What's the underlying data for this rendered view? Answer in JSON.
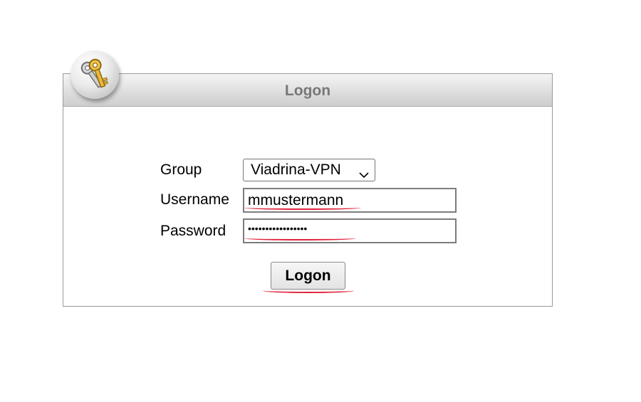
{
  "panel": {
    "title": "Logon"
  },
  "icons": {
    "badge": "keys-icon"
  },
  "form": {
    "group_label": "Group",
    "group_value": "Viadrina-VPN",
    "username_label": "Username",
    "username_value": "mmustermann",
    "password_label": "Password",
    "password_mask": "•••••••••••••••••"
  },
  "actions": {
    "logon_label": "Logon"
  },
  "colors": {
    "spellcheck_underline": "#e0233c",
    "header_text": "#777777",
    "panel_border": "#9a9a9a"
  }
}
